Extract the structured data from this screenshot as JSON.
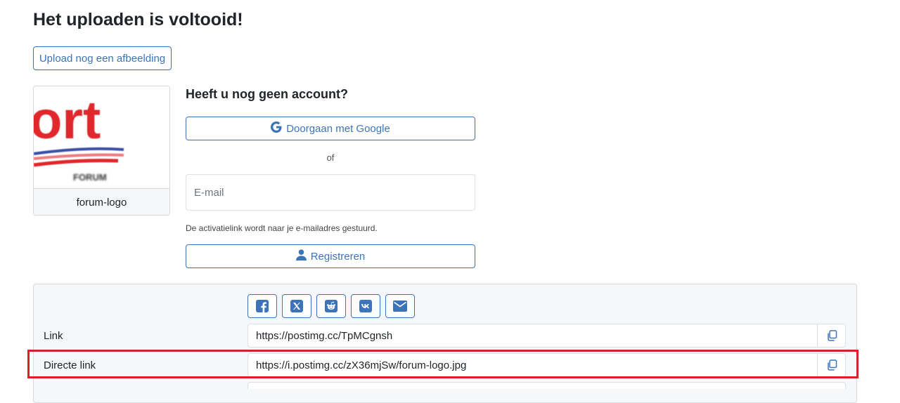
{
  "page": {
    "title": "Het uploaden is voltooid!",
    "upload_another_label": "Upload nog een afbeelding"
  },
  "thumbnail": {
    "caption": "forum-logo",
    "logo_text": "ort",
    "logo_subtext": "FORUM"
  },
  "signup": {
    "title": "Heeft u nog geen account?",
    "google_label": "Doorgaan met Google",
    "or_label": "of",
    "email_placeholder": "E-mail",
    "activation_note": "De activatielink wordt naar je e-mailadres gestuurd.",
    "register_label": "Registreren"
  },
  "share": {
    "buttons": [
      "facebook-icon",
      "x-icon",
      "reddit-icon",
      "vk-icon",
      "email-icon"
    ]
  },
  "links": [
    {
      "label": "Link",
      "value": "https://postimg.cc/TpMCgnsh"
    },
    {
      "label": "Directe link",
      "value": "https://i.postimg.cc/zX36mjSw/forum-logo.jpg"
    }
  ],
  "colors": {
    "accent": "#3d74b9",
    "highlight": "#d9202a",
    "panel_bg": "#f6f7f8"
  }
}
